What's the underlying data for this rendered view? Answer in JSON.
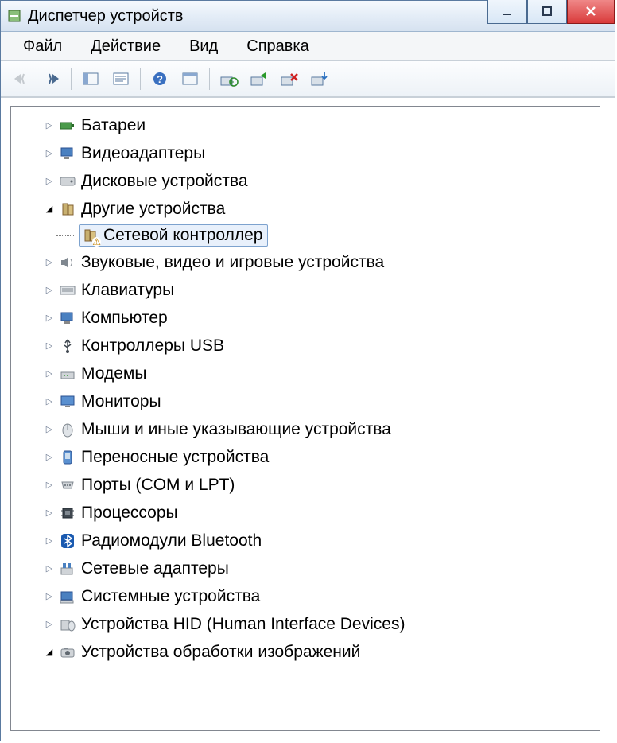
{
  "window": {
    "title": "Диспетчер устройств"
  },
  "menu": {
    "file": "Файл",
    "action": "Действие",
    "view": "Вид",
    "help": "Справка"
  },
  "tree": {
    "batteries": "Батареи",
    "displayAdapters": "Видеоадаптеры",
    "diskDrives": "Дисковые устройства",
    "otherDevices": "Другие устройства",
    "networkController": "Сетевой контроллер",
    "soundVideoGame": "Звуковые, видео и игровые устройства",
    "keyboards": "Клавиатуры",
    "computer": "Компьютер",
    "usbControllers": "Контроллеры USB",
    "modems": "Модемы",
    "monitors": "Мониторы",
    "mice": "Мыши и иные указывающие устройства",
    "portable": "Переносные устройства",
    "ports": "Порты (COM и LPT)",
    "processors": "Процессоры",
    "bluetooth": "Радиомодули Bluetooth",
    "netAdapters": "Сетевые адаптеры",
    "systemDevices": "Системные устройства",
    "hidDevices": "Устройства HID (Human Interface Devices)",
    "imaging": "Устройства обработки изображений"
  }
}
